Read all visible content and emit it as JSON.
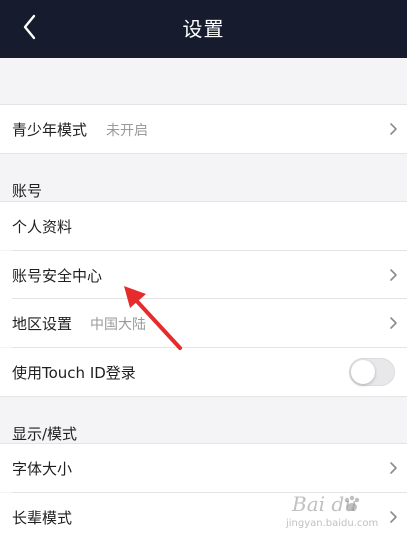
{
  "navbar": {
    "back_icon": "chevron-left-icon",
    "title": "设置",
    "background": "#161b2e"
  },
  "rows": {
    "youth_mode": {
      "label": "青少年模式",
      "value": "未开启"
    },
    "account_header": "账号",
    "profile": {
      "label": "个人资料"
    },
    "security_center": {
      "label": "账号安全中心"
    },
    "region": {
      "label": "地区设置",
      "value": "中国大陆"
    },
    "touch_id": {
      "label": "使用Touch ID登录",
      "enabled": false
    },
    "display_header": "显示/模式",
    "font_size": {
      "label": "字体大小"
    },
    "elder_mode": {
      "label": "长辈模式"
    }
  },
  "annotation": {
    "arrow_color": "#e52b2b"
  },
  "watermark": {
    "logo": "Bai du",
    "sub": "jingyan.baidu.com"
  }
}
